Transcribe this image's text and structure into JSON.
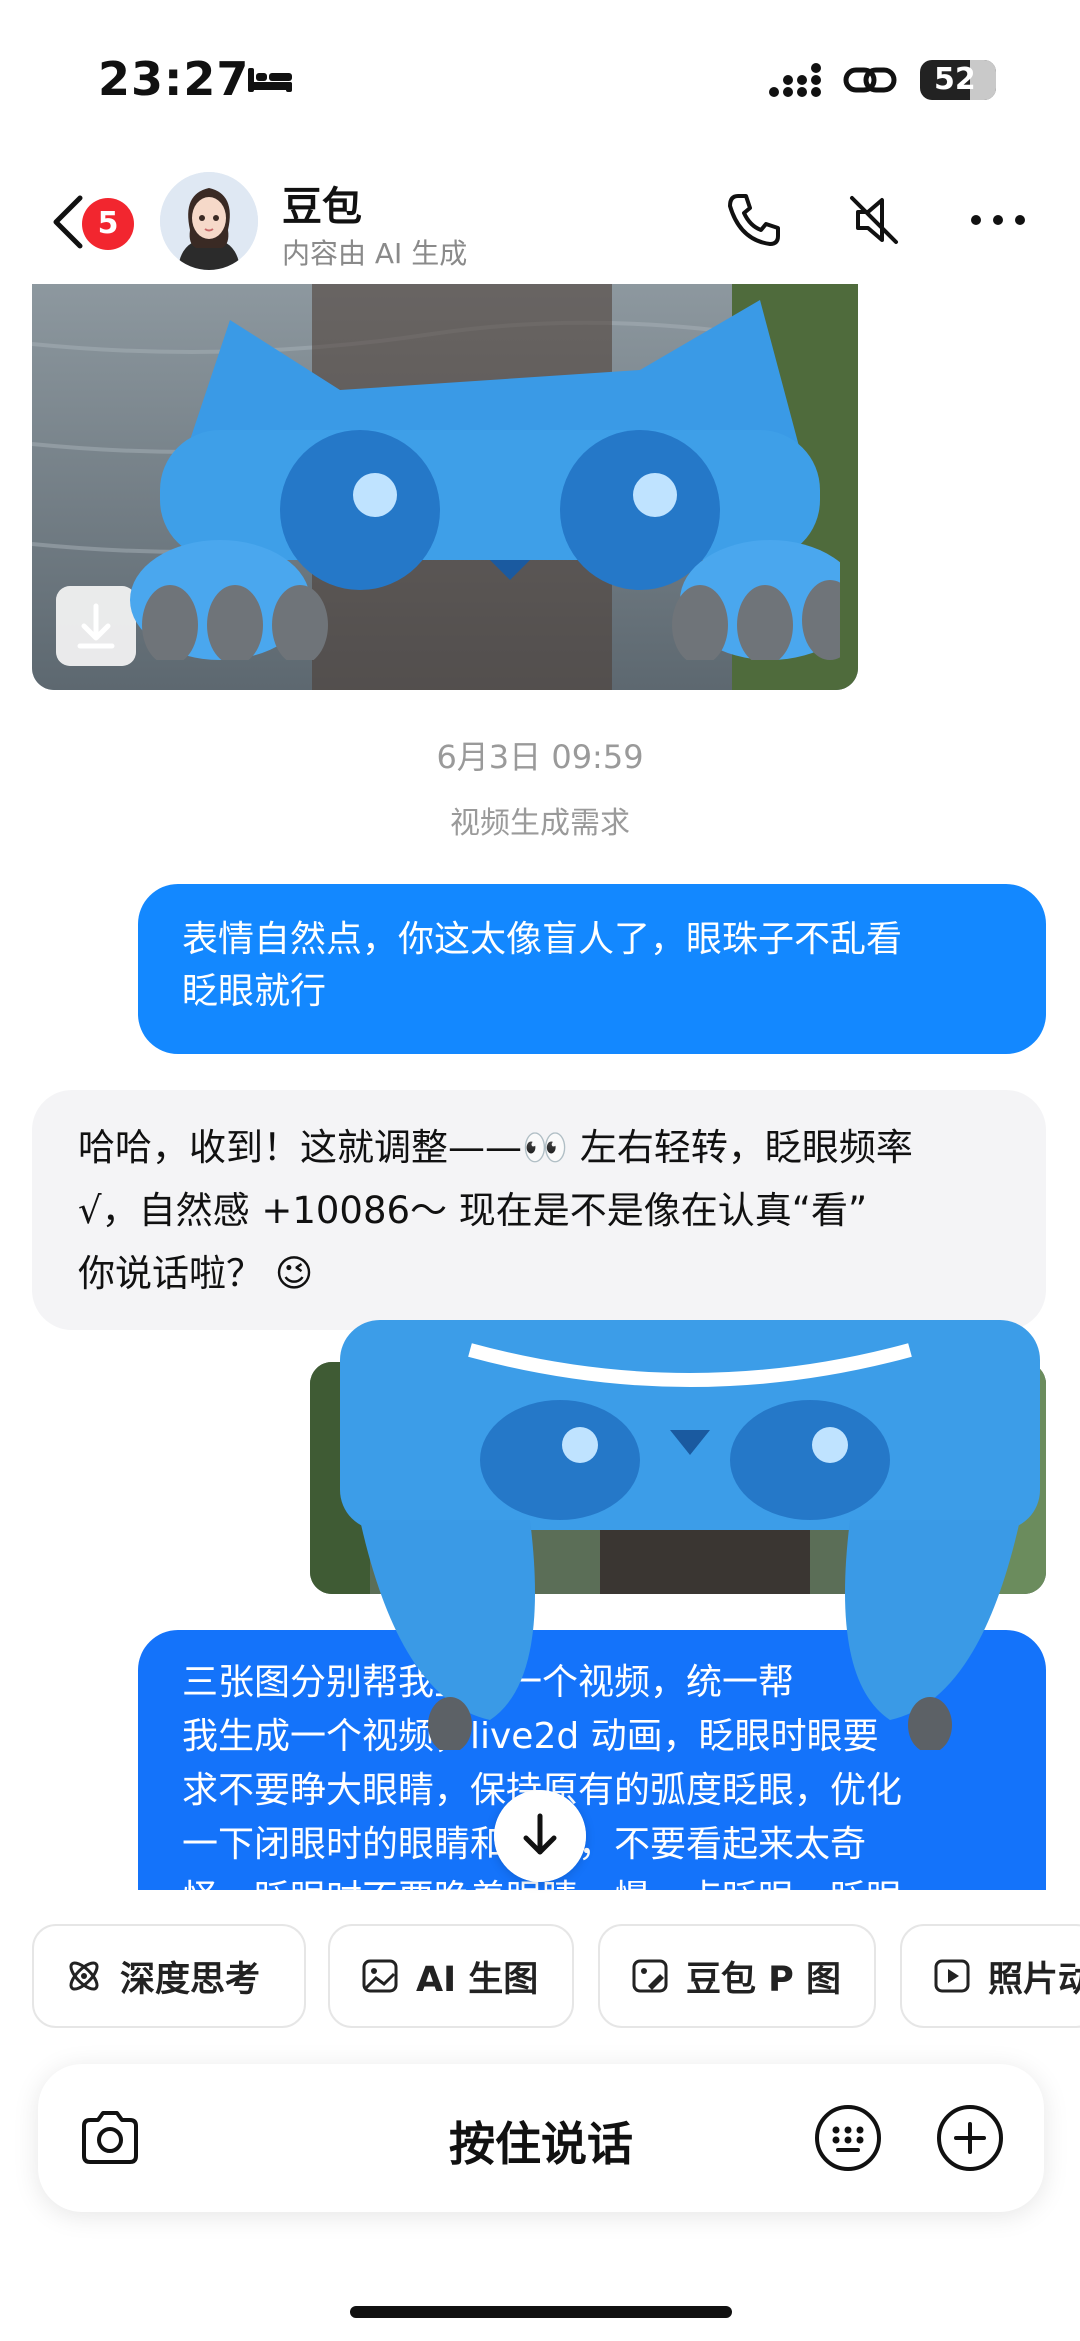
{
  "status_bar": {
    "time": "23:27",
    "battery": "52"
  },
  "header": {
    "unread_badge": "5",
    "contact_name": "豆包",
    "contact_subtitle": "内容由 AI 生成"
  },
  "chat": {
    "timestamp": "6月3日 09:59",
    "topic": "视频生成需求",
    "msg_user_1": "表情自然点，你这太像盲人了，眼珠子不乱看\n眨眼就行",
    "msg_ai_1": "哈哈，收到！这就调整——👀 左右轻转，眨眼频率\n√，自然感 +10086～ 现在是不是像在认真“看”\n你说话啦？ 😉",
    "msg_user_2": "三张图分别帮我生成一个视频，统一帮\n我生成一个视频，live2d 动画，眨眼时眼要\n求不要睁大眼睛，保持原有的弧度眨眼，优化\n一下闭眼时的眼睛和睫毛，不要看起来太奇\n怪，眨眼时不要睁着眼睛，慢一点眨眼，眨眼"
  },
  "quick_actions": [
    {
      "label": "深度思考",
      "icon": "atom-icon"
    },
    {
      "label": "AI 生图",
      "icon": "image-icon"
    },
    {
      "label": "豆包 P 图",
      "icon": "image-edit-icon"
    },
    {
      "label": "照片动",
      "icon": "play-icon"
    }
  ],
  "input_bar": {
    "hold_to_talk": "按住说话"
  },
  "colors": {
    "user_bubble": "#1388ff",
    "ai_bubble": "#f4f4f6",
    "badge": "#f2262f"
  }
}
